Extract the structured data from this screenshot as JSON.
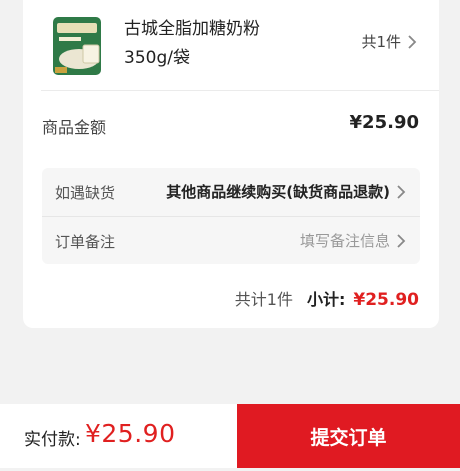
{
  "product": {
    "name": "古城全脂加糖奶粉",
    "spec": "350g/袋",
    "count_text": "共1件"
  },
  "amount": {
    "label": "商品金额",
    "value": "¥25.90"
  },
  "options": {
    "out_of_stock_label": "如遇缺货",
    "out_of_stock_value": "其他商品继续购买(缺货商品退款)",
    "remark_label": "订单备注",
    "remark_placeholder": "填写备注信息"
  },
  "total": {
    "count_text": "共计1件",
    "subtotal_label": "小计:",
    "subtotal_value": "¥25.90"
  },
  "footer": {
    "pay_label": "实付款:",
    "pay_value": "¥25.90",
    "submit_label": "提交订单"
  },
  "colors": {
    "accent": "#e01a22",
    "price": "#e02020"
  }
}
